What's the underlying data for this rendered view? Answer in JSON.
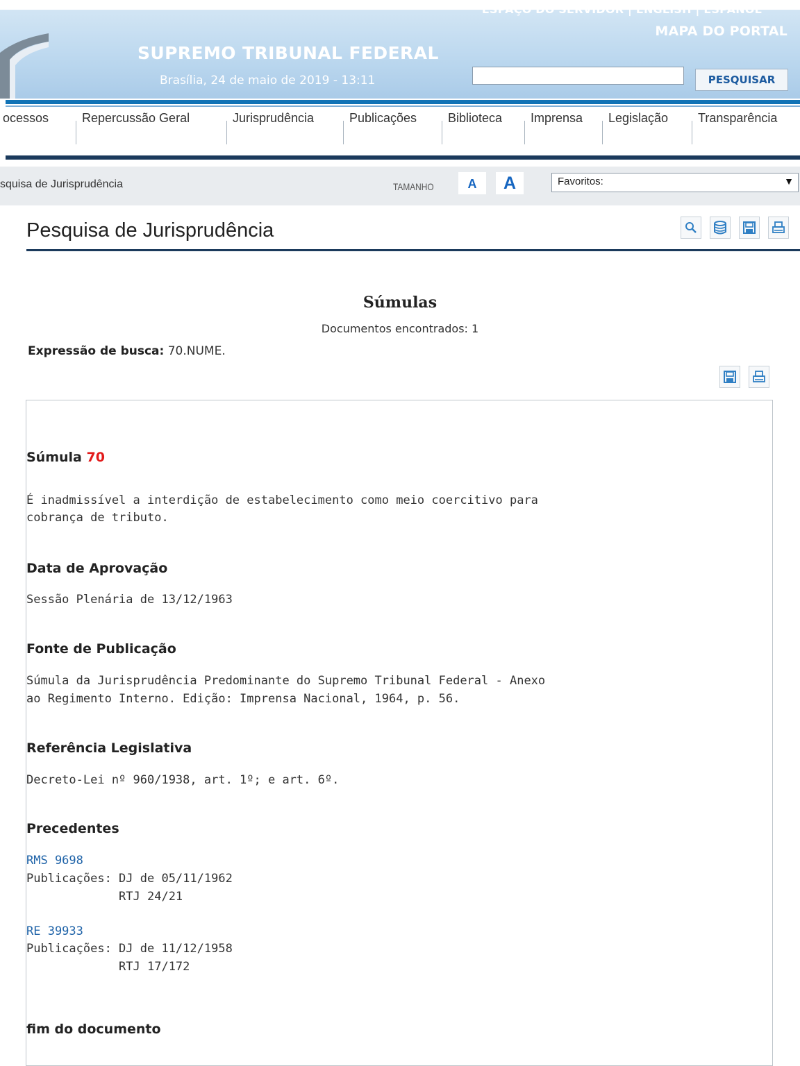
{
  "header": {
    "top_links": "ESPAÇO DO SERVIDOR | ENGLISH | ESPAÑOL",
    "portal_map": "MAPA DO PORTAL",
    "site_title": "SUPREMO TRIBUNAL FEDERAL",
    "date": "Brasília, 24 de maio de 2019 - 13:11",
    "search_value": "",
    "search_button": "PESQUISAR"
  },
  "nav": {
    "items": [
      "ocessos",
      "Repercussão Geral",
      "Jurisprudência",
      "Publicações",
      "Biblioteca",
      "Imprensa",
      "Legislação",
      "Transparência"
    ]
  },
  "breadcrumb": {
    "text": "squisa de Jurisprudência",
    "size_label": "TAMANHO",
    "font_small": "A",
    "font_large": "A",
    "favorites": "Favoritos:",
    "favorites_arrow": "▼"
  },
  "page": {
    "title": "Pesquisa de Jurisprudência",
    "result_title": "Súmulas",
    "docs_found": "Documentos encontrados: 1",
    "expr_label": "Expressão de busca:",
    "expr_value": "70.NUME."
  },
  "toolbar_icons": [
    "search-icon",
    "database-icon",
    "save-icon",
    "print-icon"
  ],
  "document": {
    "sumula_label": "Súmula",
    "sumula_number": "70",
    "text_line1": "É inadmissível a interdição de estabelecimento como meio coercitivo para",
    "text_line2": "cobrança de tributo.",
    "approval_heading": "Data de Aprovação",
    "approval_text": "Sessão Plenária de 13/12/1963",
    "source_heading": "Fonte de Publicação",
    "source_line1": "Súmula da Jurisprudência Predominante do Supremo Tribunal Federal - Anexo",
    "source_line2": "ao Regimento Interno. Edição: Imprensa Nacional, 1964, p. 56.",
    "legislation_heading": "Referência Legislativa",
    "legislation_text": "Decreto-Lei nº 960/1938, art. 1º; e art. 6º.",
    "precedents_heading": "Precedentes",
    "precedents": [
      {
        "id": "RMS 9698",
        "pub_line1": "Publicações: DJ de 05/11/1962",
        "pub_line2": "             RTJ 24/21"
      },
      {
        "id": "RE 39933",
        "pub_line1": "Publicações: DJ de 11/12/1958",
        "pub_line2": "             RTJ 17/172"
      }
    ],
    "end_label": "fim do documento"
  }
}
